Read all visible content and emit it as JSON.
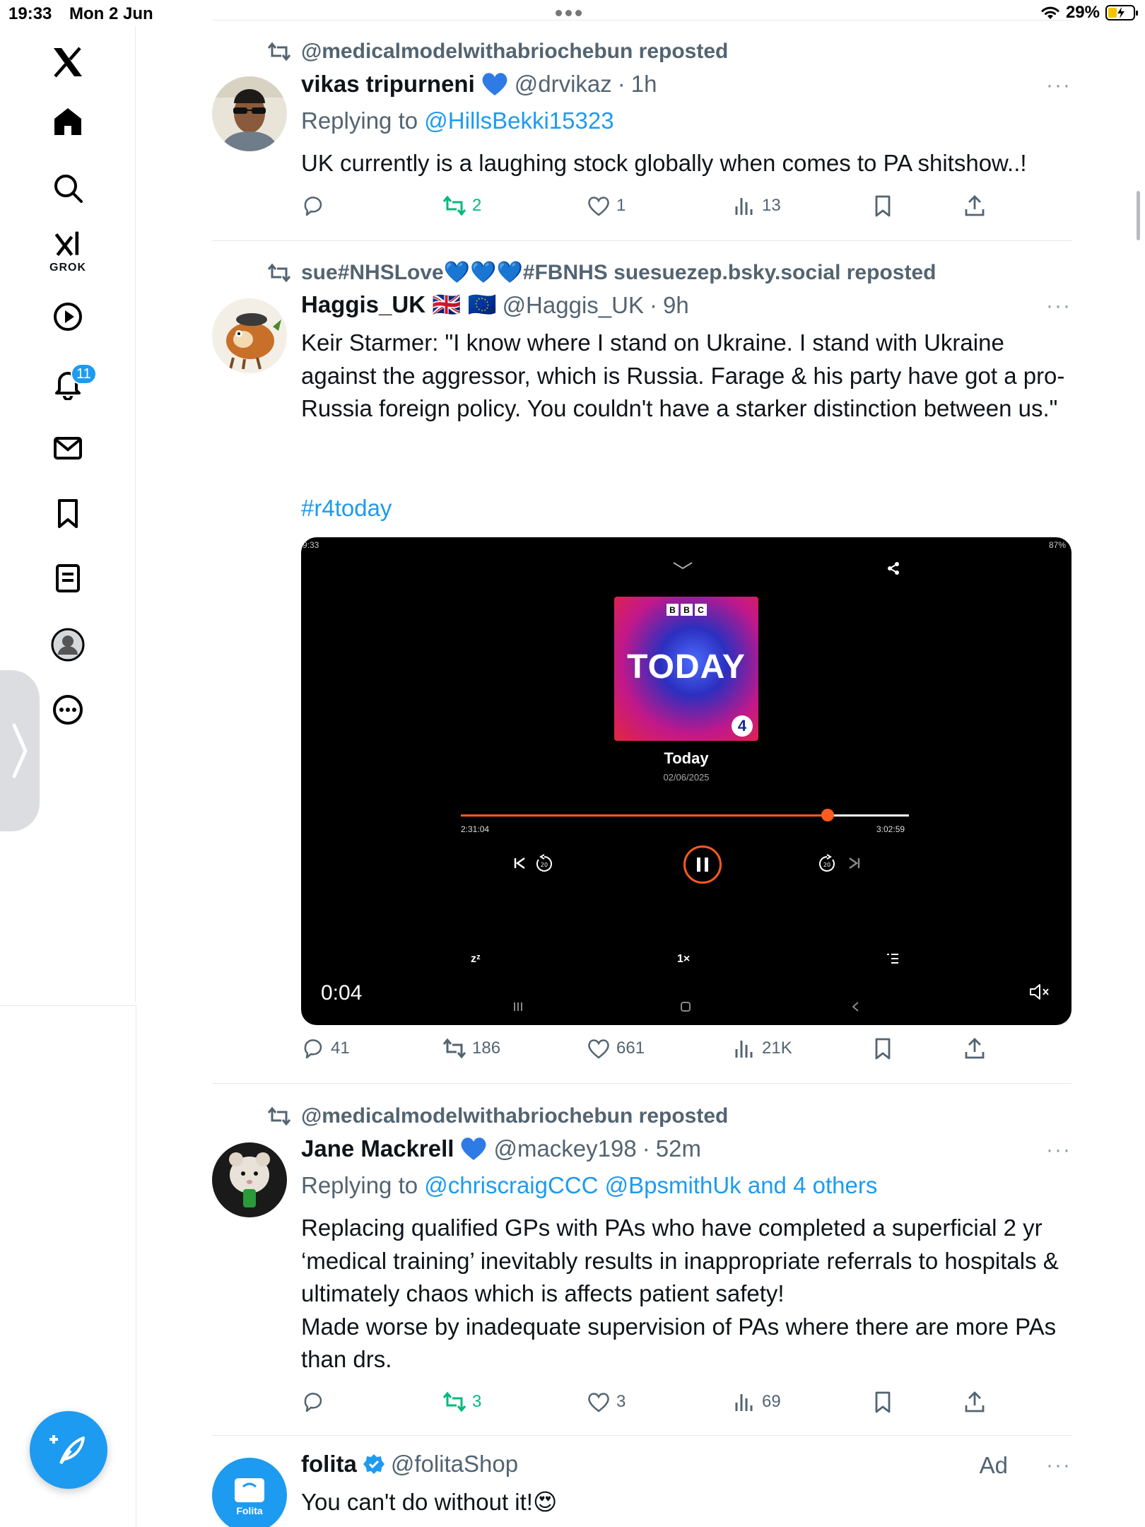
{
  "status_bar": {
    "time": "19:33",
    "date": "Mon 2 Jun",
    "battery": "29%"
  },
  "nav": {
    "grok_label": "GROK",
    "notifications_badge": "11",
    "icons": [
      "x-logo-icon",
      "home-icon",
      "search-icon",
      "grok-icon",
      "video-icon",
      "notifications-icon",
      "messages-icon",
      "bookmarks-icon",
      "lists-icon",
      "profile-icon",
      "more-icon"
    ]
  },
  "tweets": [
    {
      "repost_by": "@medicalmodelwithabriochebun reposted",
      "name": "vikas tripurneni",
      "handle": "@drvikaz",
      "time": "1h",
      "replying_prefix": "Replying to",
      "replying_to": "@HillsBekki15323",
      "text": "UK currently is a laughing stock globally when comes to PA shitshow..!",
      "stats": {
        "replies": "",
        "reposts": "2",
        "likes": "1",
        "views": "13"
      }
    },
    {
      "repost_by": "sue#NHSLove💙💙💙#FBNHS suesuezep.bsky.social reposted",
      "name": "Haggis_UK 🇬🇧 🇪🇺",
      "handle": "@Haggis_UK",
      "time": "9h",
      "text": "Keir Starmer: \"I know where I stand on Ukraine. I stand with Ukraine against the aggressor, which is Russia. Farage & his party have got a pro-Russia foreign policy. You couldn't have a starker distinction between us.\"",
      "hashtag": "#r4today",
      "video": {
        "phone_time": "9:33",
        "phone_battery": "87%",
        "bbc_letters": [
          "B",
          "B",
          "C"
        ],
        "cover_title": "TODAY",
        "cover_number": "4",
        "episode_title": "Today",
        "episode_date": "02/06/2025",
        "elapsed": "2:31:04",
        "total": "3:02:59",
        "progress_fraction": 0.818,
        "speed": "1×",
        "sleep": "zᶻ",
        "video_elapsed": "0:04"
      },
      "stats": {
        "replies": "41",
        "reposts": "186",
        "likes": "661",
        "views": "21K"
      }
    },
    {
      "repost_by": "@medicalmodelwithabriochebun reposted",
      "name": "Jane Mackrell",
      "handle": "@mackey198",
      "time": "52m",
      "replying_prefix": "Replying to",
      "replying_to": "@chriscraigCCC @BpsmithUk and 4 others",
      "text_lines": [
        "Replacing qualified GPs with PAs who have completed a superficial 2 yr ‘medical training’ inevitably results in inappropriate referrals to hospitals & ultimately chaos which is affects patient safety!",
        "Made worse by inadequate supervision of PAs where there are more PAs than drs."
      ],
      "stats": {
        "replies": "",
        "reposts": "3",
        "likes": "3",
        "views": "69"
      }
    },
    {
      "name": "folita",
      "handle": "@folitaShop",
      "ad_label": "Ad",
      "avatar_text": "Folita",
      "text": "You can't do without it!😍"
    }
  ],
  "colors": {
    "accent": "#1d9bf0",
    "repost_green": "#00ba7c",
    "muted": "#536471",
    "player_orange": "#ff5a1f"
  }
}
